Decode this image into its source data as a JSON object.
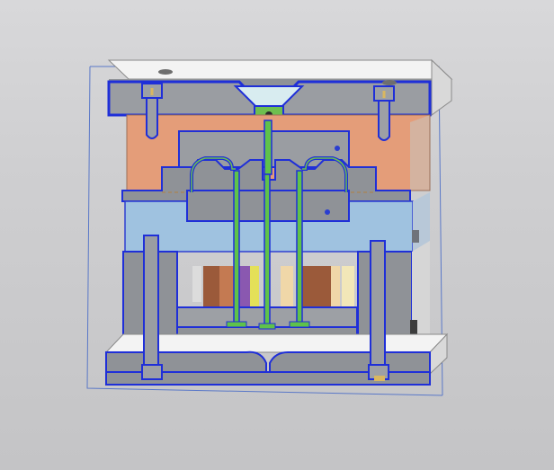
{
  "viewport": {
    "background_top": "#d8d8da",
    "background_bottom": "#c4c4c6"
  },
  "model": {
    "name": "",
    "colors": {
      "steel_face": "#8f9297",
      "steel_face_light": "#9da0a5",
      "top_face": "#f3f3f3",
      "side_face": "#d9d9d9",
      "section_outline": "#1f2fd8",
      "cavity_plate": "#e49d79",
      "core_plate": "#9fc2e0",
      "runner_green": "#5fc24a",
      "selection_box": "#5a78c8",
      "pillar_brown": "#9b5a3a",
      "pillar_cream": "#f0d7a8",
      "pillar_purple": "#8a58b0",
      "pillar_yellow": "#e4e058"
    },
    "components": [
      "top-clamp-plate-icon",
      "sprue-bushing-icon",
      "cavity-plate-icon",
      "core-plate-icon",
      "support-pillar-icon",
      "ejector-plate-icon",
      "bottom-clamp-plate-icon",
      "screw-icon",
      "ejector-pin-icon"
    ]
  }
}
